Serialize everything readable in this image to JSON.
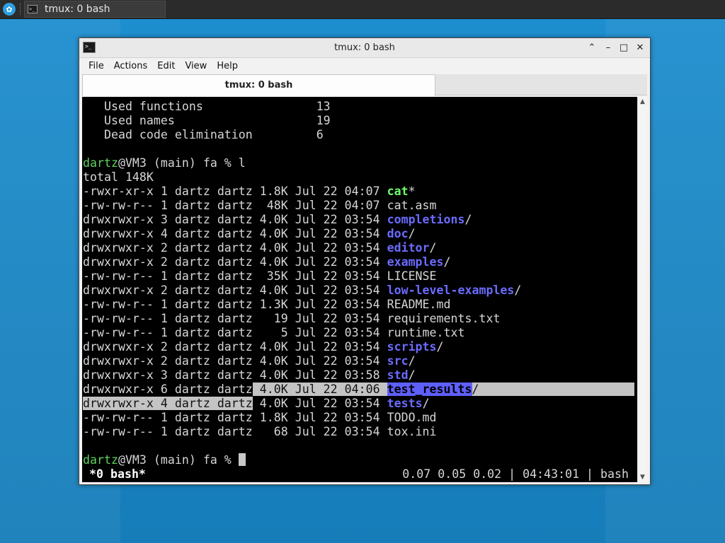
{
  "taskbar": {
    "menu_icon": "xfce-menu-icon",
    "tasks": [
      {
        "label": "tmux: 0 bash",
        "icon": "terminal-icon"
      }
    ]
  },
  "window": {
    "title": "tmux: 0 bash",
    "menu": [
      "File",
      "Actions",
      "Edit",
      "View",
      "Help"
    ],
    "tab_label": "tmux: 0 bash",
    "controls": {
      "minimize": "^",
      "restore": "-",
      "maximize": "□",
      "close": "✕"
    }
  },
  "terminal": {
    "stats": [
      {
        "label": "Used functions",
        "value": "13"
      },
      {
        "label": "Used names",
        "value": "19"
      },
      {
        "label": "Dead code elimination",
        "value": "6"
      }
    ],
    "prompt": {
      "user": "dartz",
      "rest": "@VM3 (main) fa % ",
      "command": "l"
    },
    "total": "total 148K",
    "listing": [
      {
        "perms": "-rwxr-xr-x",
        "links": "1",
        "owner": "dartz",
        "group": "dartz",
        "size": "1.8K",
        "date": "Jul 22 04:07",
        "name": "cat",
        "suffix": "*",
        "kind": "exec"
      },
      {
        "perms": "-rw-rw-r--",
        "links": "1",
        "owner": "dartz",
        "group": "dartz",
        "size": "48K",
        "date": "Jul 22 04:07",
        "name": "cat.asm",
        "suffix": "",
        "kind": "file"
      },
      {
        "perms": "drwxrwxr-x",
        "links": "3",
        "owner": "dartz",
        "group": "dartz",
        "size": "4.0K",
        "date": "Jul 22 03:54",
        "name": "completions",
        "suffix": "/",
        "kind": "dir"
      },
      {
        "perms": "drwxrwxr-x",
        "links": "4",
        "owner": "dartz",
        "group": "dartz",
        "size": "4.0K",
        "date": "Jul 22 03:54",
        "name": "doc",
        "suffix": "/",
        "kind": "dir"
      },
      {
        "perms": "drwxrwxr-x",
        "links": "2",
        "owner": "dartz",
        "group": "dartz",
        "size": "4.0K",
        "date": "Jul 22 03:54",
        "name": "editor",
        "suffix": "/",
        "kind": "dir"
      },
      {
        "perms": "drwxrwxr-x",
        "links": "2",
        "owner": "dartz",
        "group": "dartz",
        "size": "4.0K",
        "date": "Jul 22 03:54",
        "name": "examples",
        "suffix": "/",
        "kind": "dir"
      },
      {
        "perms": "-rw-rw-r--",
        "links": "1",
        "owner": "dartz",
        "group": "dartz",
        "size": "35K",
        "date": "Jul 22 03:54",
        "name": "LICENSE",
        "suffix": "",
        "kind": "file"
      },
      {
        "perms": "drwxrwxr-x",
        "links": "2",
        "owner": "dartz",
        "group": "dartz",
        "size": "4.0K",
        "date": "Jul 22 03:54",
        "name": "low-level-examples",
        "suffix": "/",
        "kind": "dir"
      },
      {
        "perms": "-rw-rw-r--",
        "links": "1",
        "owner": "dartz",
        "group": "dartz",
        "size": "1.3K",
        "date": "Jul 22 03:54",
        "name": "README.md",
        "suffix": "",
        "kind": "file"
      },
      {
        "perms": "-rw-rw-r--",
        "links": "1",
        "owner": "dartz",
        "group": "dartz",
        "size": "19",
        "date": "Jul 22 03:54",
        "name": "requirements.txt",
        "suffix": "",
        "kind": "file"
      },
      {
        "perms": "-rw-rw-r--",
        "links": "1",
        "owner": "dartz",
        "group": "dartz",
        "size": "5",
        "date": "Jul 22 03:54",
        "name": "runtime.txt",
        "suffix": "",
        "kind": "file"
      },
      {
        "perms": "drwxrwxr-x",
        "links": "2",
        "owner": "dartz",
        "group": "dartz",
        "size": "4.0K",
        "date": "Jul 22 03:54",
        "name": "scripts",
        "suffix": "/",
        "kind": "dir"
      },
      {
        "perms": "drwxrwxr-x",
        "links": "2",
        "owner": "dartz",
        "group": "dartz",
        "size": "4.0K",
        "date": "Jul 22 03:54",
        "name": "src",
        "suffix": "/",
        "kind": "dir"
      },
      {
        "perms": "drwxrwxr-x",
        "links": "3",
        "owner": "dartz",
        "group": "dartz",
        "size": "4.0K",
        "date": "Jul 22 03:58",
        "name": "std",
        "suffix": "/",
        "kind": "dir"
      },
      {
        "perms": "drwxrwxr-x",
        "links": "6",
        "owner": "dartz",
        "group": "dartz",
        "size": "4.0K",
        "date": "Jul 22 04:06",
        "name": "test_results",
        "suffix": "/",
        "kind": "dir",
        "selection": "tail"
      },
      {
        "perms": "drwxrwxr-x",
        "links": "4",
        "owner": "dartz",
        "group": "dartz",
        "size": "4.0K",
        "date": "Jul 22 03:54",
        "name": "tests",
        "suffix": "/",
        "kind": "dir",
        "selection": "head"
      },
      {
        "perms": "-rw-rw-r--",
        "links": "1",
        "owner": "dartz",
        "group": "dartz",
        "size": "1.8K",
        "date": "Jul 22 03:54",
        "name": "TODO.md",
        "suffix": "",
        "kind": "file"
      },
      {
        "perms": "-rw-rw-r--",
        "links": "1",
        "owner": "dartz",
        "group": "dartz",
        "size": "68",
        "date": "Jul 22 03:54",
        "name": "tox.ini",
        "suffix": "",
        "kind": "file"
      }
    ],
    "final_prompt": {
      "user": "dartz",
      "rest": "@VM3 (main) fa % "
    },
    "status_bar": {
      "left": "*0 bash*",
      "right": "0.07 0.05 0.02 | 04:43:01 | bash"
    },
    "colors": {
      "user": "#5fd35f",
      "dir": "#6b6bff",
      "exec": "#6aff6a",
      "selection": "#c4c4c4"
    }
  }
}
